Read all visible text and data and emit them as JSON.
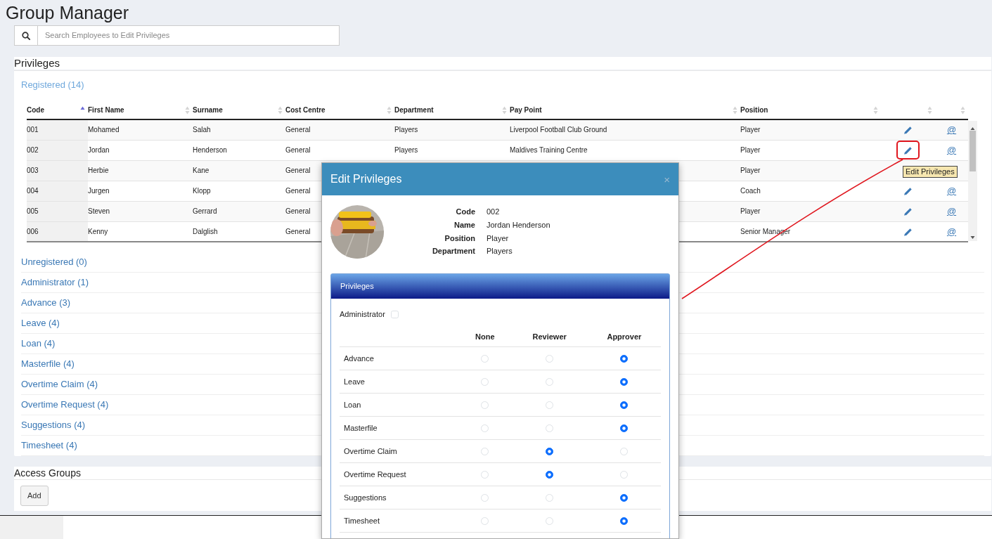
{
  "page": {
    "title": "Group Manager"
  },
  "search": {
    "placeholder": "Search Employees to Edit Privileges"
  },
  "privileges_panel": {
    "title": "Privileges",
    "sections": [
      {
        "label": "Registered (14)",
        "expanded": true
      },
      {
        "label": "Unregistered (0)",
        "expanded": false
      },
      {
        "label": "Administrator (1)",
        "expanded": false
      },
      {
        "label": "Advance (3)",
        "expanded": false
      },
      {
        "label": "Leave (4)",
        "expanded": false
      },
      {
        "label": "Loan (4)",
        "expanded": false
      },
      {
        "label": "Masterfile (4)",
        "expanded": false
      },
      {
        "label": "Overtime Claim (4)",
        "expanded": false
      },
      {
        "label": "Overtime Request (4)",
        "expanded": false
      },
      {
        "label": "Suggestions (4)",
        "expanded": false
      },
      {
        "label": "Timesheet (4)",
        "expanded": false
      }
    ],
    "table": {
      "columns": [
        {
          "label": "Code",
          "sorted": true
        },
        {
          "label": "First Name",
          "sorted": false
        },
        {
          "label": "Surname",
          "sorted": false
        },
        {
          "label": "Cost Centre",
          "sorted": false
        },
        {
          "label": "Department",
          "sorted": false
        },
        {
          "label": "Pay Point",
          "sorted": false
        },
        {
          "label": "Position",
          "sorted": false
        },
        {
          "sorted": false
        },
        {
          "sorted": false
        }
      ],
      "rows": [
        {
          "cells": [
            "001",
            "Mohamed",
            "Salah",
            "General",
            "Players",
            "Liverpool Football Club Ground",
            "Player"
          ],
          "actions": true,
          "at": "@",
          "highlighted": false
        },
        {
          "cells": [
            "002",
            "Jordan",
            "Henderson",
            "General",
            "Players",
            "Maldives Training Centre",
            "Player"
          ],
          "actions": true,
          "at": "@",
          "highlighted": true
        },
        {
          "cells": [
            "003",
            "Herbie",
            "Kane",
            "General",
            null,
            null,
            "Player"
          ],
          "actions": false
        },
        {
          "cells": [
            "004",
            "Jurgen",
            "Klopp",
            "General",
            null,
            null,
            "Coach"
          ],
          "actions": true,
          "at": "@",
          "highlighted": false
        },
        {
          "cells": [
            "005",
            "Steven",
            "Gerrard",
            "General",
            null,
            null,
            "Player"
          ],
          "actions": true,
          "at": "@",
          "highlighted": false
        },
        {
          "cells": [
            "006",
            "Kenny",
            "Dalglish",
            "General",
            null,
            null,
            "Senior Manager"
          ],
          "actions": true,
          "at": "@",
          "highlighted": false
        }
      ],
      "tooltip": "Edit Privileges"
    }
  },
  "access_groups": {
    "title": "Access Groups",
    "add_button": "Add"
  },
  "modal": {
    "title": "Edit Privileges",
    "close": "×",
    "details": [
      {
        "label": "Code",
        "value": "002"
      },
      {
        "label": "Name",
        "value": "Jordan Henderson"
      },
      {
        "label": "Position",
        "value": "Player"
      },
      {
        "label": "Department",
        "value": "Players"
      }
    ],
    "privileges": {
      "title": "Privileges",
      "administrator": {
        "label": "Administrator",
        "checked": false
      },
      "levels": [
        "None",
        "Reviewer",
        "Approver"
      ],
      "rows": [
        {
          "label": "Advance",
          "options": [
            {
              "selected": false
            },
            {
              "selected": false
            },
            {
              "selected": true
            }
          ]
        },
        {
          "label": "Leave",
          "options": [
            {
              "selected": false
            },
            {
              "selected": false
            },
            {
              "selected": true
            }
          ]
        },
        {
          "label": "Loan",
          "options": [
            {
              "selected": false
            },
            {
              "selected": false
            },
            {
              "selected": true
            }
          ]
        },
        {
          "label": "Masterfile",
          "options": [
            {
              "selected": false
            },
            {
              "selected": false
            },
            {
              "selected": true
            }
          ]
        },
        {
          "label": "Overtime Claim",
          "options": [
            {
              "selected": false
            },
            {
              "selected": true
            },
            {
              "selected": false
            }
          ]
        },
        {
          "label": "Overtime Request",
          "options": [
            {
              "selected": false
            },
            {
              "selected": true
            },
            {
              "selected": false
            }
          ]
        },
        {
          "label": "Suggestions",
          "options": [
            {
              "selected": false
            },
            {
              "selected": false
            },
            {
              "selected": true
            }
          ]
        },
        {
          "label": "Timesheet",
          "options": [
            {
              "selected": false
            },
            {
              "selected": false
            },
            {
              "selected": true
            }
          ]
        }
      ]
    }
  }
}
